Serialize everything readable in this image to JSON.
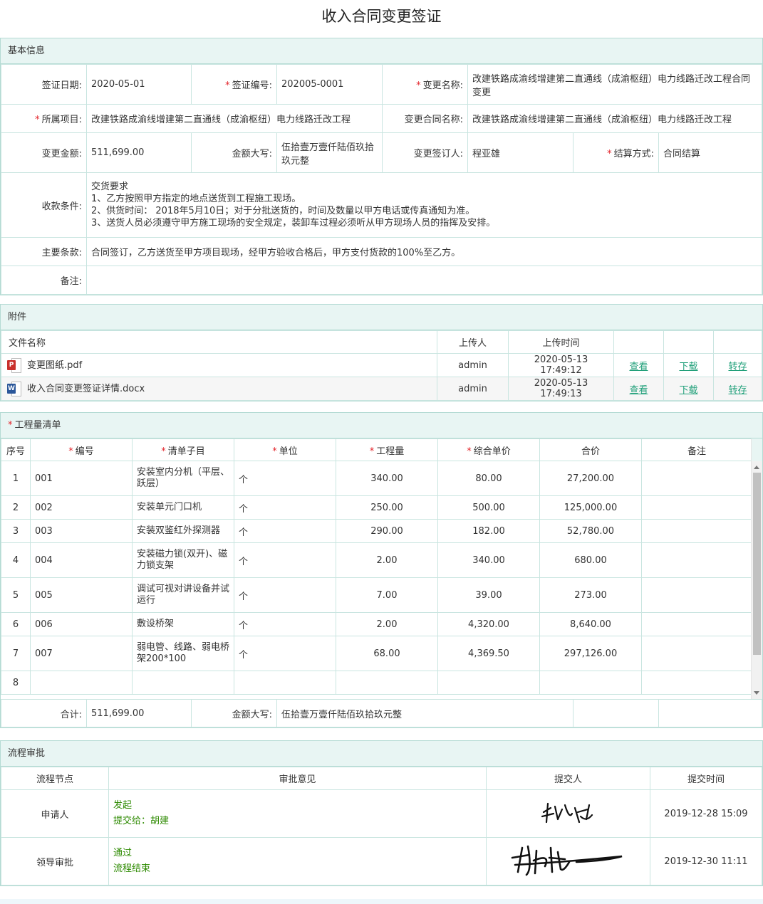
{
  "title": "收入合同变更签证",
  "basic": {
    "header": "基本信息",
    "date_label": "签证日期:",
    "date": "2020-05-01",
    "no_label": "签证编号:",
    "no": "202005-0001",
    "name_label": "变更名称:",
    "name": "改建铁路成渝线增建第二直通线（成渝枢纽）电力线路迁改工程合同变更",
    "project_label": "所属项目:",
    "project": "改建铁路成渝线增建第二直通线（成渝枢纽）电力线路迁改工程",
    "contract_label": "变更合同名称:",
    "contract": "改建铁路成渝线增建第二直通线（成渝枢纽）电力线路迁改工程",
    "amount_label": "变更金额:",
    "amount": "511,699.00",
    "upper_label": "金额大写:",
    "upper": "伍拾壹万壹仟陆佰玖拾玖元整",
    "signer_label": "变更签订人:",
    "signer": "程亚雄",
    "settle_label": "结算方式:",
    "settle": "合同结算",
    "terms_label": "收款条件:",
    "terms": [
      "交货要求",
      "1、乙方按照甲方指定的地点送货到工程施工现场。",
      "2、供货时间： 2018年5月10日；对于分批送货的，时间及数量以甲方电话或传真通知为准。",
      "3、送货人员必须遵守甲方施工现场的安全规定，装卸车过程必须听从甲方现场人员的指挥及安排。"
    ],
    "main_label": "主要条款:",
    "main": "合同签订，乙方送货至甲方项目现场，经甲方验收合格后，甲方支付货款的100%至乙方。",
    "remark_label": "备注:",
    "remark": ""
  },
  "attach": {
    "header": "附件",
    "cols": [
      "文件名称",
      "上传人",
      "上传时间"
    ],
    "files": [
      {
        "icon": "pdf-file-icon",
        "tag": "P",
        "color": "#c9302c",
        "name": "变更图纸.pdf",
        "user": "admin",
        "time": "2020-05-13 17:49:12",
        "view": "查看",
        "down": "下载",
        "save": "转存"
      },
      {
        "icon": "word-file-icon",
        "tag": "W",
        "color": "#2b579a",
        "name": "收入合同变更签证详情.docx",
        "user": "admin",
        "time": "2020-05-13 17:49:13",
        "view": "查看",
        "down": "下载",
        "save": "转存"
      }
    ]
  },
  "bill": {
    "header": "工程量清单",
    "cols": [
      "序号",
      "编号",
      "清单子目",
      "单位",
      "工程量",
      "综合单价",
      "合价",
      "备注"
    ],
    "rows": [
      {
        "no": "1",
        "code": "001",
        "item": "安装室内分机（平层、跃层）",
        "unit": "个",
        "qty": "340.00",
        "price": "80.00",
        "total": "27,200.00",
        "remark": ""
      },
      {
        "no": "2",
        "code": "002",
        "item": "安装单元门口机",
        "unit": "个",
        "qty": "250.00",
        "price": "500.00",
        "total": "125,000.00",
        "remark": ""
      },
      {
        "no": "3",
        "code": "003",
        "item": "安装双鉴红外探测器",
        "unit": "个",
        "qty": "290.00",
        "price": "182.00",
        "total": "52,780.00",
        "remark": ""
      },
      {
        "no": "4",
        "code": "004",
        "item": "安装磁力锁(双开)、磁力锁支架",
        "unit": "个",
        "qty": "2.00",
        "price": "340.00",
        "total": "680.00",
        "remark": ""
      },
      {
        "no": "5",
        "code": "005",
        "item": "调试可视对讲设备并试运行",
        "unit": "个",
        "qty": "7.00",
        "price": "39.00",
        "total": "273.00",
        "remark": ""
      },
      {
        "no": "6",
        "code": "006",
        "item": "敷设桥架",
        "unit": "个",
        "qty": "2.00",
        "price": "4,320.00",
        "total": "8,640.00",
        "remark": ""
      },
      {
        "no": "7",
        "code": "007",
        "item": "弱电管、线路、弱电桥架200*100",
        "unit": "个",
        "qty": "68.00",
        "price": "4,369.50",
        "total": "297,126.00",
        "remark": ""
      },
      {
        "no": "8",
        "code": "",
        "item": "",
        "unit": "",
        "qty": "",
        "price": "",
        "total": "",
        "remark": ""
      }
    ],
    "sum_label": "合计:",
    "sum": "511,699.00",
    "sum_upper_label": "金额大写:",
    "sum_upper": "伍拾壹万壹仟陆佰玖拾玖元整"
  },
  "flow": {
    "header": "流程审批",
    "cols": [
      "流程节点",
      "审批意见",
      "提交人",
      "提交时间"
    ],
    "rows": [
      {
        "node": "申请人",
        "op1": "发起",
        "op2": "提交给：胡建",
        "sign": "张鑫",
        "time": "2019-12-28 15:09"
      },
      {
        "node": "领导审批",
        "op1": "通过",
        "op2": "流程结束",
        "sign": "胡建",
        "time": "2019-12-30 11:11"
      }
    ]
  }
}
